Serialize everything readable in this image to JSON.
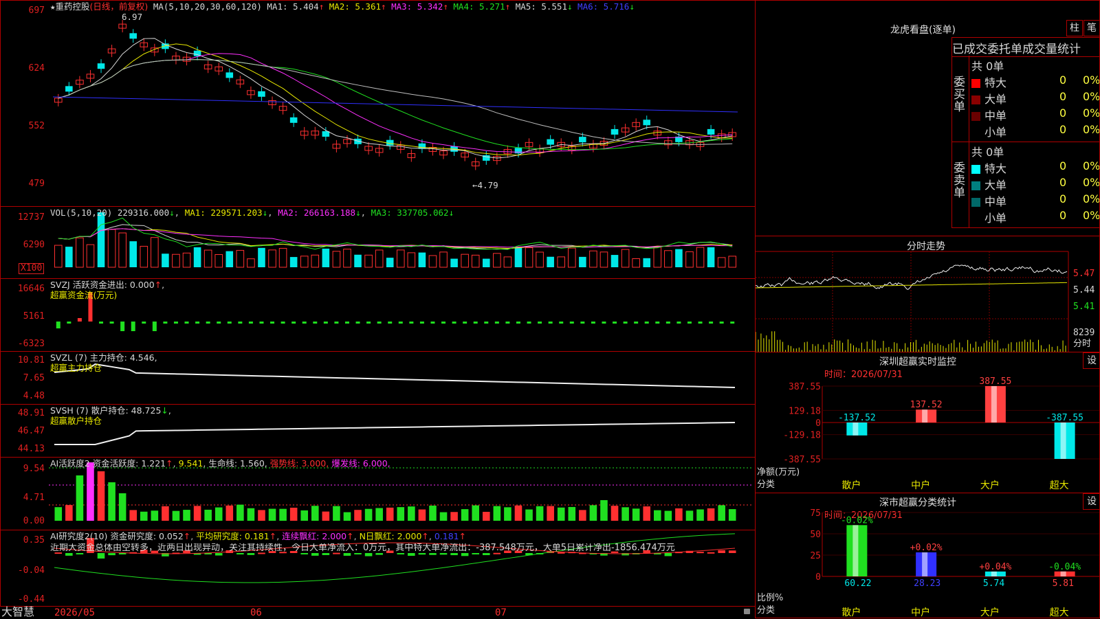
{
  "stock": {
    "name": "重药控股",
    "period": "(日线，前复权)",
    "star": "★"
  },
  "price_panel": {
    "axis": [
      "697",
      "624",
      "552",
      "479"
    ],
    "ma_header": "MA(5,10,20,30,60,120)",
    "ma": [
      {
        "label": "MA1:",
        "value": "5.404",
        "arrow": "↑",
        "color": "#d8d8d8"
      },
      {
        "label": "MA2:",
        "value": "5.361",
        "arrow": "↑",
        "color": "#e8e800"
      },
      {
        "label": "MA3:",
        "value": "5.342",
        "arrow": "↑",
        "color": "#ff30ff"
      },
      {
        "label": "MA4:",
        "value": "5.271",
        "arrow": "↑",
        "color": "#20e020"
      },
      {
        "label": "MA5:",
        "value": "5.551",
        "arrow": "↓",
        "color": "#d8d8d8"
      },
      {
        "label": "MA6:",
        "value": "5.716",
        "arrow": "↓",
        "color": "#4040ff"
      }
    ],
    "high_mark": "6.97",
    "low_mark": "←4.79"
  },
  "vol_panel": {
    "axis": [
      "12737",
      "6290"
    ],
    "unit": "X100",
    "header": "VOL(5,10,20)",
    "value": "229316.000",
    "ma1": "MA1: 229571.203",
    "ma2": "MA2: 266163.188",
    "ma3": "MA3: 337705.062"
  },
  "svzj_panel": {
    "axis": [
      "16646",
      "5161",
      "-6323"
    ],
    "header": "SVZJ  活跃资金进出: 0.000",
    "subtitle": "超赢资金流(万元)"
  },
  "svzl_panel": {
    "axis": [
      "10.81",
      "7.65",
      "4.48"
    ],
    "header": "SVZL (7) 主力持仓: 4.546,",
    "subtitle": "超赢主力持仓"
  },
  "svsh_panel": {
    "axis": [
      "48.91",
      "46.47",
      "44.13"
    ],
    "header": "SVSH (7) 散户持仓: 48.725",
    "subtitle": "超赢散户持仓"
  },
  "ai1_panel": {
    "axis": [
      "9.54",
      "4.71",
      "0.00"
    ],
    "header_a": "AI活跃度2 资金活跃度: 1.221",
    "header_b": "9.541",
    "header_c": "生命线: 1.560,",
    "header_d": "强势线: 3.000,",
    "header_e": "爆发线: 6.000,"
  },
  "ai2_panel": {
    "axis": [
      "0.35",
      "-0.04",
      "-0.44"
    ],
    "header_a": "AI研究度2(10) 资金研究度: 0.052",
    "header_b": "平均研究度: 0.181",
    "header_c": "连续飘红: 2.000",
    "header_d": "N日飘红: 2.000",
    "header_e": "0.181",
    "comment": "近期大资金总体由空转多，近两日出现异动，关注其持续性，今日大单净流入：0万元，其中特大单净流出：-387.548万元，大单5日累计净出-1856.474万元"
  },
  "time_axis": {
    "brand": "大智慧",
    "labels": [
      "2026/05",
      "06",
      "07"
    ]
  },
  "lhb": {
    "title": "龙虎看盘(逐单)",
    "btn_zhu": "柱",
    "btn_bi": "笔",
    "tabs": [
      "已成交",
      "委托单",
      "成交量统计"
    ],
    "buy": {
      "side": "委买单",
      "total": "共 0单",
      "rows": [
        {
          "label": "特大",
          "n": "0",
          "p": "0%",
          "color": "#ff0000"
        },
        {
          "label": "大单",
          "n": "0",
          "p": "0%",
          "color": "#8a0000"
        },
        {
          "label": "中单",
          "n": "0",
          "p": "0%",
          "color": "#6a0000"
        },
        {
          "label": "小单",
          "n": "0",
          "p": "0%",
          "color": "#000000"
        }
      ]
    },
    "sell": {
      "side": "委卖单",
      "total": "共 0单",
      "rows": [
        {
          "label": "特大",
          "n": "0",
          "p": "0%",
          "color": "#00ffff"
        },
        {
          "label": "大单",
          "n": "0",
          "p": "0%",
          "color": "#008080"
        },
        {
          "label": "中单",
          "n": "0",
          "p": "0%",
          "color": "#006868"
        },
        {
          "label": "小单",
          "n": "0",
          "p": "0%",
          "color": "#000000"
        }
      ]
    }
  },
  "fenshi": {
    "title": "分时走势",
    "axis": [
      "5.47",
      "5.44",
      "5.41"
    ],
    "vol": "8239",
    "vol_unit": "分时"
  },
  "sz_monitor": {
    "title": "深圳超赢实时监控",
    "btn": "设",
    "time": "时间：2026/07/31",
    "axis": [
      "387.55",
      "129.18",
      "0",
      "-129.18",
      "-387.55"
    ],
    "ylabel": "净额(万元)",
    "xlabel": "分类",
    "chart_data": {
      "type": "bar",
      "categories": [
        "散户",
        "中户",
        "大户",
        "超大"
      ],
      "values": [
        -137.52,
        137.52,
        387.55,
        -387.55
      ],
      "value_labels": [
        "-137.52",
        "137.52",
        "387.55",
        "-387.55"
      ],
      "ylim": [
        -387.55,
        387.55
      ]
    }
  },
  "sz_class": {
    "title": "深市超赢分类统计",
    "btn": "设",
    "time": "时间：2026/07/31",
    "axis": [
      "75",
      "50",
      "25",
      "0"
    ],
    "ylabel": "比例%",
    "xlabel": "分类",
    "chart_data": {
      "type": "bar",
      "categories": [
        "散户",
        "中户",
        "大户",
        "超大"
      ],
      "values": [
        60.22,
        28.23,
        5.74,
        5.81
      ],
      "value_labels": [
        "60.22",
        "28.23",
        "5.74",
        "5.81"
      ],
      "changes": [
        "-0.02%",
        "+0.02%",
        "+0.04%",
        "-0.04%"
      ],
      "ylim": [
        0,
        75
      ]
    }
  }
}
